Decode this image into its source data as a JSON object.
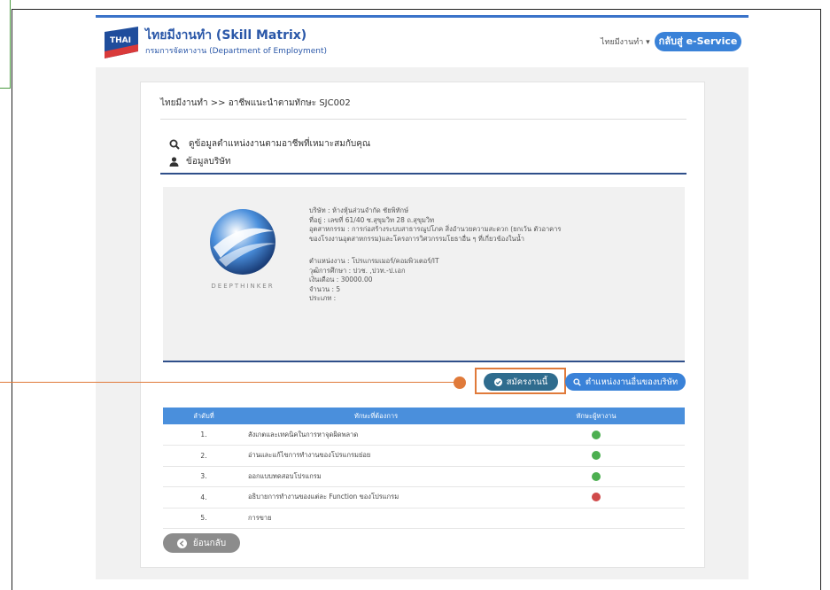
{
  "header": {
    "title": "ไทยมีงานทำ (Skill Matrix)",
    "subtitle": "กรมการจัดหางาน (Department of Employment)",
    "logo_text": "THAI มีงานทำ",
    "lang_label": "ไทยมีงานทำ ▾",
    "eservice_label": "กลับสู่ e-Service"
  },
  "breadcrumb": "ไทยมีงานทำ >> อาชีพแนะนำตามทักษะ SJC002",
  "search_title": "ดูข้อมูลตำแหน่งงานตามอาชีพที่เหมาะสมกับคุณ",
  "company_section_title": "ข้อมูลบริษัท",
  "company": {
    "logo_caption": "DEEPTHINKER",
    "name": "บริษัท : ห้างหุ้นส่วนจำกัด ชัยพิทักษ์",
    "address": "ที่อยู่ : เลขที่ 61/40 ซ.สุขุมวิท 28 ถ.สุขุมวิท",
    "industry_line1": "อุตสาหกรรม : การก่อสร้างระบบสาธารณูปโภค สิ่งอำนวยความสะดวก (ยกเว้น ตัวอาคาร",
    "industry_line2": "ของโรงงานอุตสาหกรรม)และโครงการวิศวกรรมโยธาอื่น ๆ ที่เกี่ยวข้องในน้ำ",
    "position": "ตำแหน่งงาน : โปรแกรมเมอร์/คอมพิวเตอร์/IT",
    "education": "วุฒิการศึกษา : ปวช. ,ปวท.-ป.เอก",
    "salary": "เงินเดือน : 30000.00",
    "count": "จำนวน : 5",
    "type": "ประเภท :"
  },
  "actions": {
    "apply_label": "สมัครงานนี้",
    "other_jobs_label": "ตำแหน่งงานอื่นของบริษัท"
  },
  "table": {
    "headers": [
      "ลำดับที่",
      "ทักษะที่ต้องการ",
      "ทักษะผู้หางาน"
    ],
    "rows": [
      {
        "num": "1.",
        "skill": "สังเกตและเทคนิคในการหาจุดผิดพลาด",
        "status": "ok"
      },
      {
        "num": "2.",
        "skill": "อ่านและแก้ไขการทำงานของโปรแกรมย่อย",
        "status": "ok"
      },
      {
        "num": "3.",
        "skill": "ออกแบบทดสอบโปรแกรม",
        "status": "ok"
      },
      {
        "num": "4.",
        "skill": "อธิบายการทำงานของแต่ละ Function ของโปรแกรม",
        "status": "missing"
      },
      {
        "num": "5.",
        "skill": "การขาย",
        "status": "none"
      }
    ]
  },
  "back_label": "ย้อนกลับ",
  "colors": {
    "accent": "#3a82d8",
    "highlight": "#e07a3a",
    "ok": "#4caf50",
    "missing": "#d04a4a"
  }
}
